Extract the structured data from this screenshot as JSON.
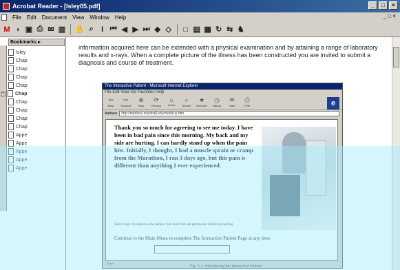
{
  "window": {
    "title": "Acrobat Reader - [Isley05.pdf]",
    "controls": [
      "_",
      "□",
      "×"
    ]
  },
  "menu": {
    "items": [
      "File",
      "Edit",
      "Document",
      "View",
      "Window",
      "Help"
    ],
    "right": "_ □ ×"
  },
  "toolbar": {
    "buttons": [
      {
        "icon": "M",
        "name": "hand-tool-icon"
      },
      {
        "icon": "◖",
        "name": "back-icon"
      },
      {
        "icon": "▣",
        "name": "open-icon"
      },
      {
        "icon": "⎙",
        "name": "print-icon"
      },
      {
        "icon": "✉",
        "name": "email-icon"
      },
      {
        "icon": "▥",
        "name": "show-navigation-icon"
      },
      {
        "icon": "✋",
        "name": "hand-icon"
      },
      {
        "icon": "⌕",
        "name": "zoom-icon"
      },
      {
        "icon": "I",
        "name": "text-select-icon"
      },
      {
        "icon": "⏮",
        "name": "first-page-icon"
      },
      {
        "icon": "◀",
        "name": "previous-page-icon"
      },
      {
        "icon": "▶",
        "name": "next-page-icon"
      },
      {
        "icon": "⏭",
        "name": "last-page-icon"
      },
      {
        "icon": "◆",
        "name": "go-back-icon"
      },
      {
        "icon": "◇",
        "name": "go-forward-icon"
      },
      {
        "icon": "□",
        "name": "actual-size-icon"
      },
      {
        "icon": "▤",
        "name": "fit-page-icon"
      },
      {
        "icon": "▦",
        "name": "fit-width-icon"
      },
      {
        "icon": "↻",
        "name": "rotate-icon"
      },
      {
        "icon": "⇆",
        "name": "rotate-cw-icon"
      },
      {
        "icon": "♞",
        "name": "find-icon"
      }
    ]
  },
  "bookmarks": {
    "header": "Bookmarks ▸",
    "items": [
      {
        "label": "Isley",
        "selected": false
      },
      {
        "label": "Chap",
        "selected": false
      },
      {
        "label": "Chap",
        "selected": false
      },
      {
        "label": "Chap",
        "selected": false
      },
      {
        "label": "Chap",
        "selected": false
      },
      {
        "label": "Chap",
        "selected": true
      },
      {
        "label": "Chap",
        "selected": false
      },
      {
        "label": "Chap",
        "selected": false
      },
      {
        "label": "Chap",
        "selected": false
      },
      {
        "label": "Chap",
        "selected": false
      },
      {
        "label": "Appe",
        "selected": false
      },
      {
        "label": "Appe",
        "selected": false
      },
      {
        "label": "Appe",
        "selected": false
      },
      {
        "label": "Appe",
        "selected": false
      },
      {
        "label": "Appe",
        "selected": false
      }
    ]
  },
  "document": {
    "paragraph": "information acquired here can be extended with a physical examination and by attaining a range of laboratory results and x-rays. When a complete picture of the illness has been constructed you are invited to submit a diagnosis and course of treatment.",
    "caption": "Fig. 5-1. Introducing the Interactive Patient"
  },
  "browser": {
    "title": "The Interactive Patient - Microsoft Internet Explorer",
    "menu": "File  Edit  View  Go  Favorites  Help",
    "tools": [
      {
        "icon": "⇦",
        "label": "Back"
      },
      {
        "icon": "⇨",
        "label": "Forward"
      },
      {
        "icon": "⊗",
        "label": "Stop"
      },
      {
        "icon": "⟳",
        "label": "Refresh"
      },
      {
        "icon": "⌂",
        "label": "Home"
      },
      {
        "icon": "⌕",
        "label": "Search"
      },
      {
        "icon": "★",
        "label": "Favorites"
      },
      {
        "icon": "◷",
        "label": "History"
      },
      {
        "icon": "✉",
        "label": "Mail"
      },
      {
        "icon": "⎙",
        "label": "Print"
      }
    ],
    "logo": "e",
    "address_label": "Address",
    "address": "http://medicus.marshall.edu/medicus.htm",
    "patient_text": "Thank you so much for agreeing to see me today. I have been in bad pain since this morning. My back and my side are hurting. I can hardly stand up when the pain hits. Initially, I thought, I had a muscle sprain or cramp from the Marathon, I ran 3 days ago, but this pain is different than anything I ever experienced.",
    "small_text": "Select topics to interview the patient. You must first ask permission before proceeding.",
    "link_text": "Continue to the Main Menu to complete The Interactive Patient Page at any time.",
    "status": "Done"
  }
}
